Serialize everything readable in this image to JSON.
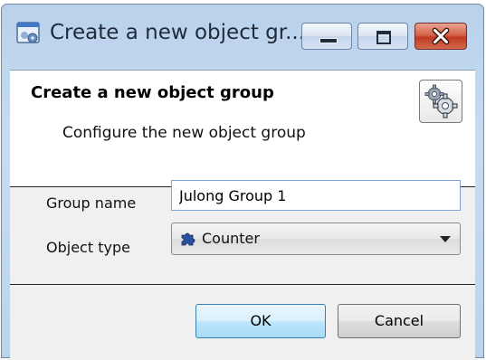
{
  "window": {
    "title": "Create a new object gr...",
    "app_icon": "dialog-window-icon",
    "controls": {
      "minimize": "minimize-icon",
      "maximize": "maximize-icon",
      "close": "close-icon"
    }
  },
  "header": {
    "title": "Create a new object group",
    "subtitle": "Configure the new object group",
    "icon": "gears-icon"
  },
  "form": {
    "group_name_label": "Group name",
    "group_name_value": "Julong Group 1",
    "object_type_label": "Object type",
    "object_type_value": "Counter",
    "object_type_icon": "counter-puzzle-icon"
  },
  "buttons": {
    "ok_label": "OK",
    "cancel_label": "Cancel"
  },
  "colors": {
    "close_button": "#c7452c",
    "ok_button_border": "#3c7fb1",
    "title_bar": "#c2d8ef"
  }
}
